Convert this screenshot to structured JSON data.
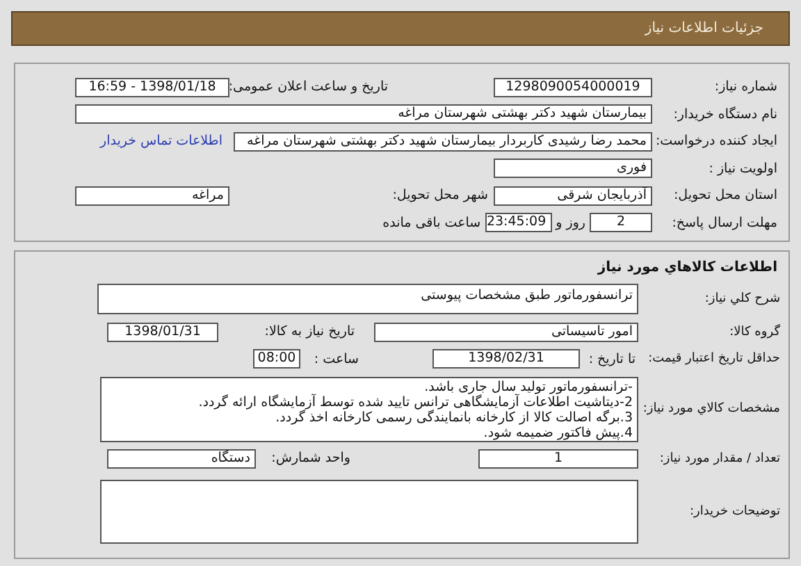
{
  "header": {
    "title": "جزئیات اطلاعات نیاز"
  },
  "need_info": {
    "need_number": {
      "label": "شماره نیاز:",
      "value": "1298090054000019"
    },
    "announce": {
      "label": "تاریخ و ساعت اعلان عمومی:",
      "value": "1398/01/18 - 16:59"
    },
    "buyer": {
      "label": "نام دستگاه خریدار:",
      "value": "بیمارستان شهید دکتر بهشتی شهرستان مراغه"
    },
    "creator": {
      "label": "ایجاد کننده درخواست:",
      "value": "محمد رضا رشیدی کاربردار بیمارستان شهید دکتر بهشتی شهرستان مراغه"
    },
    "contact_link": "اطلاعات تماس خریدار",
    "priority": {
      "label": "اولویت نیاز :",
      "value": "فوری"
    },
    "province": {
      "label": "استان محل تحویل:",
      "value": "آذربایجان شرقی"
    },
    "city": {
      "label": "شهر محل تحویل:",
      "value": "مراغه"
    },
    "deadline": {
      "label": "مهلت ارسال پاسخ:",
      "days": "2",
      "days_unit": "روز و",
      "time": "23:45:09",
      "remaining": "ساعت باقی مانده"
    }
  },
  "goods": {
    "title": "اطلاعات كالاهاي مورد نياز",
    "summary": {
      "label": "شرح كلي نياز:",
      "value": "ترانسفورماتور طبق مشخصات پیوستی"
    },
    "group": {
      "label": "گروه کالا:",
      "value": "امور تاسیساتی"
    },
    "need_date": {
      "label": "تاریخ نیاز به کالا:",
      "value": "1398/01/31"
    },
    "validity": {
      "label": "حداقل تاریخ اعتبار قیمت:",
      "until_label": "تا تاریخ :",
      "date": "1398/02/31",
      "time_label": "ساعت :",
      "time": "08:00"
    },
    "specs": {
      "label": "مشخصات كالاي مورد نياز:",
      "lines": [
        "-ترانسفورماتور تولید سال جاری باشد.",
        "2-دیتاشیت اطلاعات آزمایشگاهی ترانس تایید شده توسط آزمایشگاه ارائه گردد.",
        "3.برگه اصالت کالا از کارخانه بانمایندگی رسمی کارخانه اخذ گردد.",
        "4.پیش فاکتور ضمیمه شود."
      ]
    },
    "quantity": {
      "label": "تعداد / مقدار مورد نیاز:",
      "value": "1"
    },
    "unit": {
      "label": "واحد شمارش:",
      "value": "دستگاه"
    },
    "buyer_notes": {
      "label": "توضیحات خریدار:"
    }
  }
}
